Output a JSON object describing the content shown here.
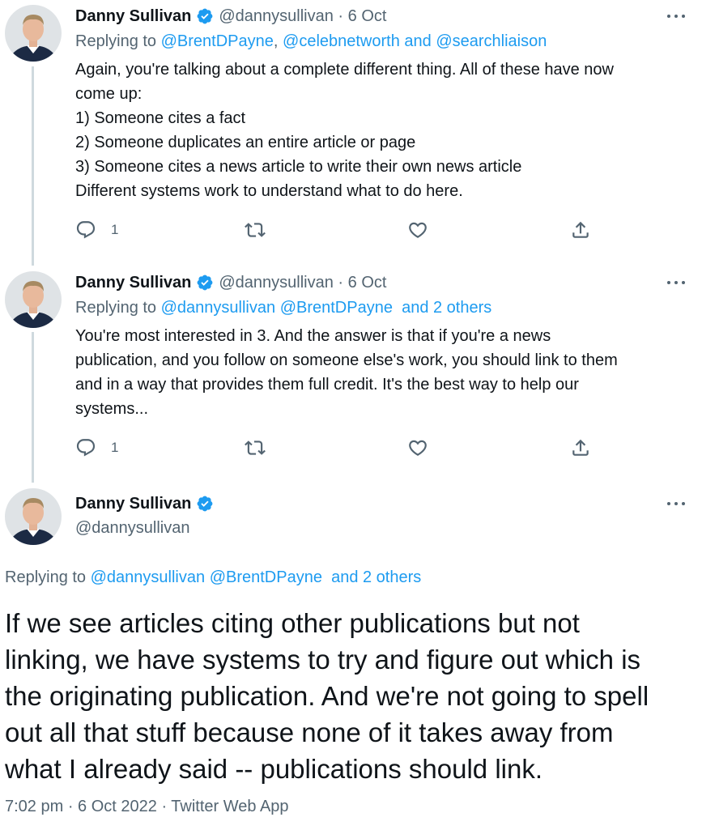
{
  "tweets": [
    {
      "name": "Danny Sullivan",
      "handle": "@dannysullivan",
      "date": "6 Oct",
      "replying_prefix": "Replying to ",
      "replying_to": [
        "@BrentDPayne",
        "@celebnetworth and @searchliaison"
      ],
      "replying_sep": ", ",
      "body": [
        "Again, you're talking about a complete different thing. All of these have now",
        "come up:",
        "1) Someone cites a fact",
        "2) Someone duplicates an entire article or page",
        "3) Someone cites a news article to write their own news article",
        "Different systems work to understand what to do here."
      ],
      "reply_count": "1"
    },
    {
      "name": "Danny Sullivan",
      "handle": "@dannysullivan",
      "date": "6 Oct",
      "replying_prefix": "Replying to ",
      "replying_to": [
        "@dannysullivan",
        "@BrentDPayne",
        "and 2 others"
      ],
      "body": [
        "You're most interested in 3. And the answer is that if you're a news",
        "publication, and you follow on someone else's work, you should link to them",
        "and in a way that provides them full credit. It's the best way to help our",
        "systems..."
      ],
      "reply_count": "1"
    }
  ],
  "main_tweet": {
    "name": "Danny Sullivan",
    "handle": "@dannysullivan",
    "replying_prefix": "Replying to ",
    "replying_to": [
      "@dannysullivan",
      "@BrentDPayne",
      "and 2 others"
    ],
    "body": [
      "If we see articles citing other publications but not",
      "linking, we have systems to try and figure out which is",
      "the originating publication. And we're not going to spell",
      "out all that stuff because none of it takes away from",
      "what I already said -- publications should link."
    ],
    "footer": "7:02 pm · 6 Oct 2022 · Twitter Web App"
  },
  "separator": " · ",
  "icons": {
    "reply": "reply-icon",
    "retweet": "retweet-icon",
    "like": "like-icon",
    "share": "share-icon",
    "verified": "verified-badge-icon",
    "more": "more-icon"
  },
  "colors": {
    "link": "#1d9bf0",
    "secondary": "#536471",
    "verified": "#1d9bf0"
  }
}
